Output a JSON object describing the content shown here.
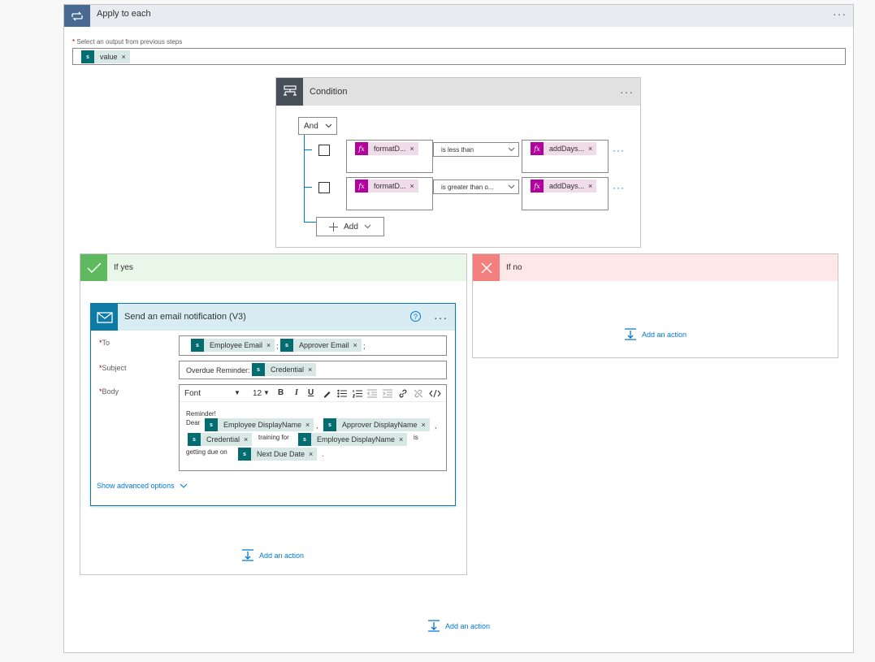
{
  "apply_to_each": {
    "title": "Apply to each",
    "more": "···",
    "required_mark": "*",
    "select_label": "Select an output from previous steps",
    "token": {
      "label": "value",
      "remove": "×"
    }
  },
  "condition": {
    "title": "Condition",
    "more": "···",
    "group_operator": "And",
    "rows": [
      {
        "left": "formatD...",
        "operator": "is less than",
        "right": "addDays...",
        "more": "···"
      },
      {
        "left": "formatD...",
        "operator": "is greater than o...",
        "right": "addDays...",
        "more": "···"
      }
    ],
    "remove": "×",
    "add_label": "Add"
  },
  "if_yes": {
    "title": "If yes",
    "add_action": "Add an action"
  },
  "if_no": {
    "title": "If no",
    "add_action": "Add an action"
  },
  "email": {
    "title": "Send an email notification (V3)",
    "help": "?",
    "more": "···",
    "to_label": "To",
    "subject_label": "Subject",
    "body_label": "Body",
    "to_tokens": [
      "Employee Email",
      "Approver Email"
    ],
    "to_sep1": ";",
    "to_sep2": ";",
    "subject_prefix": "Overdue Reminder:",
    "subject_token": "Credential",
    "toolbar": {
      "font": "Font",
      "size": "12",
      "bold": "B",
      "italic": "I",
      "underline": "U"
    },
    "body": {
      "line1": "Reminder!",
      "dear": "Dear",
      "token_emp_display": "Employee DisplayName",
      "comma": ",",
      "token_approver_display": "Approver DisplayName",
      "token_credential": "Credential",
      "training_for": "training for",
      "token_emp_display2": "Employee DisplayName",
      "is": "is",
      "getting_due_on": "getting due on",
      "token_next_due": "Next Due Date",
      "period": "."
    },
    "show_advanced": "Show advanced options",
    "remove": "×"
  },
  "bottom_add_action": "Add an action",
  "colors": {
    "accent": "#0078d4",
    "sharepoint": "#036c70",
    "expression": "#b4009e",
    "loop_header": "#486991",
    "yes_green": "#5fb95f",
    "no_red": "#f1807e"
  },
  "icons": [
    "loop-icon",
    "condition-icon",
    "check-icon",
    "close-icon",
    "mail-icon",
    "sharepoint-icon",
    "fx-icon",
    "add-action-icon",
    "chevron-down-icon",
    "plus-icon"
  ]
}
